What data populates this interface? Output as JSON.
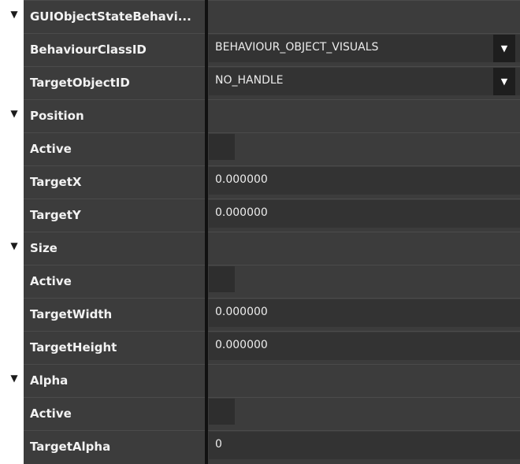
{
  "icons": {
    "expand": "▼",
    "dropdown": "▼"
  },
  "rows": [
    {
      "kind": "group",
      "label": "GUIObjectStateBehavi..."
    },
    {
      "kind": "dropdown",
      "label": "BehaviourClassID",
      "value": "BEHAVIOUR_OBJECT_VISUALS"
    },
    {
      "kind": "dropdown",
      "label": "TargetObjectID",
      "value": "NO_HANDLE"
    },
    {
      "kind": "group",
      "label": "Position"
    },
    {
      "kind": "checkbox",
      "label": "Active",
      "checked": false
    },
    {
      "kind": "text",
      "label": "TargetX",
      "value": "0.000000"
    },
    {
      "kind": "text",
      "label": "TargetY",
      "value": "0.000000"
    },
    {
      "kind": "group",
      "label": "Size"
    },
    {
      "kind": "checkbox",
      "label": "Active",
      "checked": false
    },
    {
      "kind": "text",
      "label": "TargetWidth",
      "value": "0.000000"
    },
    {
      "kind": "text",
      "label": "TargetHeight",
      "value": "0.000000"
    },
    {
      "kind": "group",
      "label": "Alpha"
    },
    {
      "kind": "checkbox",
      "label": "Active",
      "checked": false
    },
    {
      "kind": "text",
      "label": "TargetAlpha",
      "value": "0"
    }
  ]
}
